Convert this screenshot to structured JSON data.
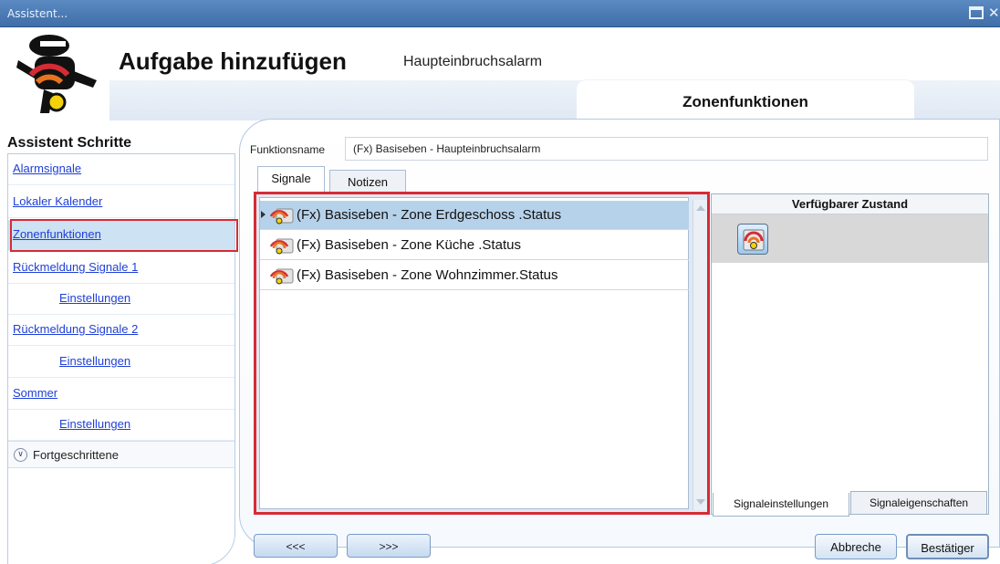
{
  "window": {
    "title": "Assistent..."
  },
  "header": {
    "title": "Aufgabe hinzufügen",
    "subtitle": "Haupteinbruchsalarm",
    "section_tab": "Zonenfunktionen"
  },
  "sidebar": {
    "title": "Assistent Schritte",
    "items": [
      {
        "label": "Alarmsignale",
        "indent": false
      },
      {
        "label": "Lokaler Kalender",
        "indent": false
      },
      {
        "label": "Zonenfunktionen",
        "indent": false,
        "selected": true
      },
      {
        "label": "Rückmeldung Signale 1",
        "indent": false
      },
      {
        "label": "Einstellungen",
        "indent": true
      },
      {
        "label": "Rückmeldung Signale 2",
        "indent": false
      },
      {
        "label": "Einstellungen",
        "indent": true
      },
      {
        "label": "Sommer",
        "indent": false
      },
      {
        "label": "Einstellungen",
        "indent": true
      }
    ],
    "advanced_label": "Fortgeschrittene"
  },
  "form": {
    "function_name_label": "Funktionsname",
    "function_name_value": "(Fx) Basiseben - Haupteinbruchsalarm",
    "tabs": [
      "Signale",
      "Notizen"
    ]
  },
  "signals": {
    "rows": [
      "(Fx) Basiseben - Zone Erdgeschoss .Status",
      "(Fx) Basiseben - Zone Küche .Status",
      "(Fx) Basiseben - Zone Wohnzimmer.Status"
    ]
  },
  "state_panel": {
    "header": "Verfügbarer Zustand",
    "bottom_tabs": [
      "Signaleinstellungen",
      "Signaleigenschaften"
    ]
  },
  "footer": {
    "back_label": "<<<",
    "next_label": ">>>",
    "cancel_label": "Abbreche",
    "confirm_label": "Bestätiger"
  },
  "colors": {
    "title_bar": "#4a79b3",
    "link": "#1f3fd6",
    "highlight_red": "#d62b35",
    "selected_row": "#b6d2ea"
  }
}
